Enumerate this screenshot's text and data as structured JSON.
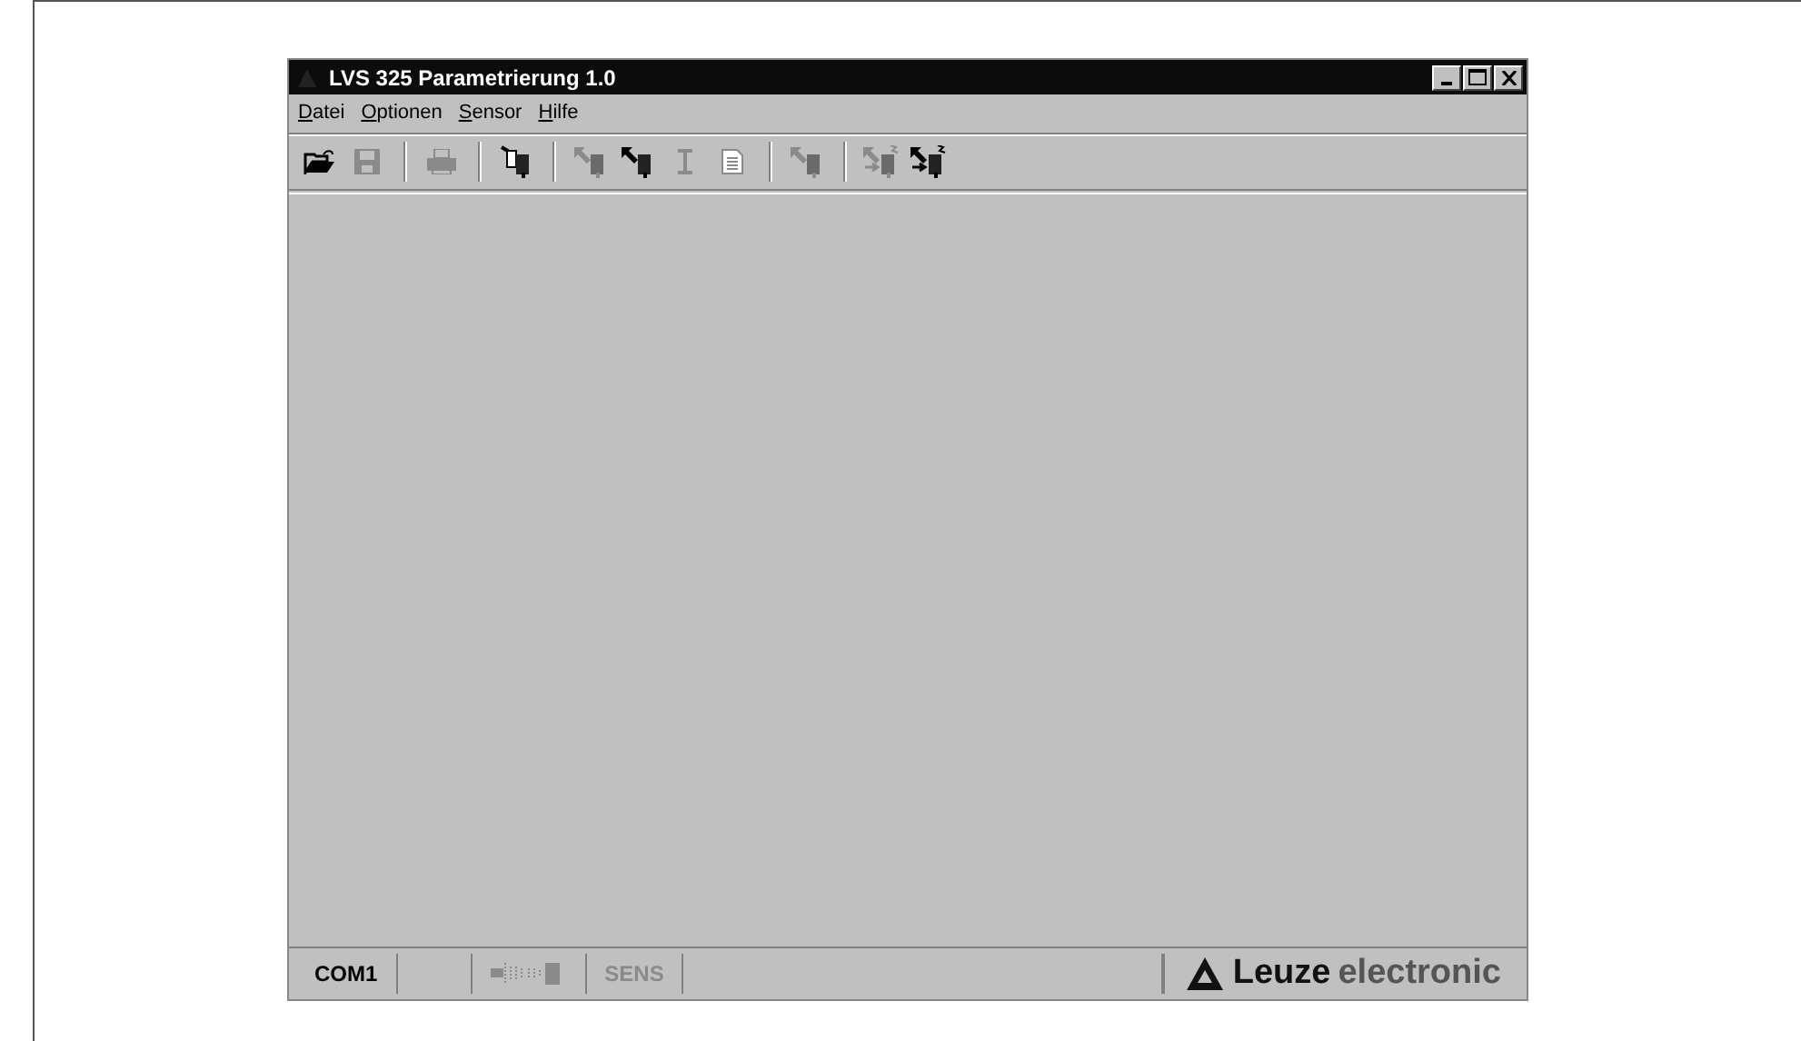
{
  "window": {
    "title": "LVS 325 Parametrierung 1.0"
  },
  "menu": [
    "Datei",
    "Optionen",
    "Sensor",
    "Hilfe"
  ],
  "toolbar": [
    [
      {
        "kind": "open",
        "disabled": false
      },
      {
        "kind": "save",
        "disabled": true
      }
    ],
    [
      {
        "kind": "print",
        "disabled": true
      }
    ],
    [
      {
        "kind": "sensor",
        "disabled": false
      }
    ],
    [
      {
        "kind": "upload",
        "disabled": true
      },
      {
        "kind": "download",
        "disabled": false
      },
      {
        "kind": "text",
        "disabled": true
      },
      {
        "kind": "document",
        "disabled": true
      }
    ],
    [
      {
        "kind": "upload",
        "disabled": true
      }
    ],
    [
      {
        "kind": "teach",
        "disabled": true
      },
      {
        "kind": "teach",
        "disabled": false
      }
    ]
  ],
  "status_bar": {
    "port": "COM1",
    "signal_disabled": true,
    "sens": {
      "label": "SENS",
      "disabled": true
    },
    "logo": {
      "brand": "Leuze",
      "suffix": "electronic"
    }
  }
}
